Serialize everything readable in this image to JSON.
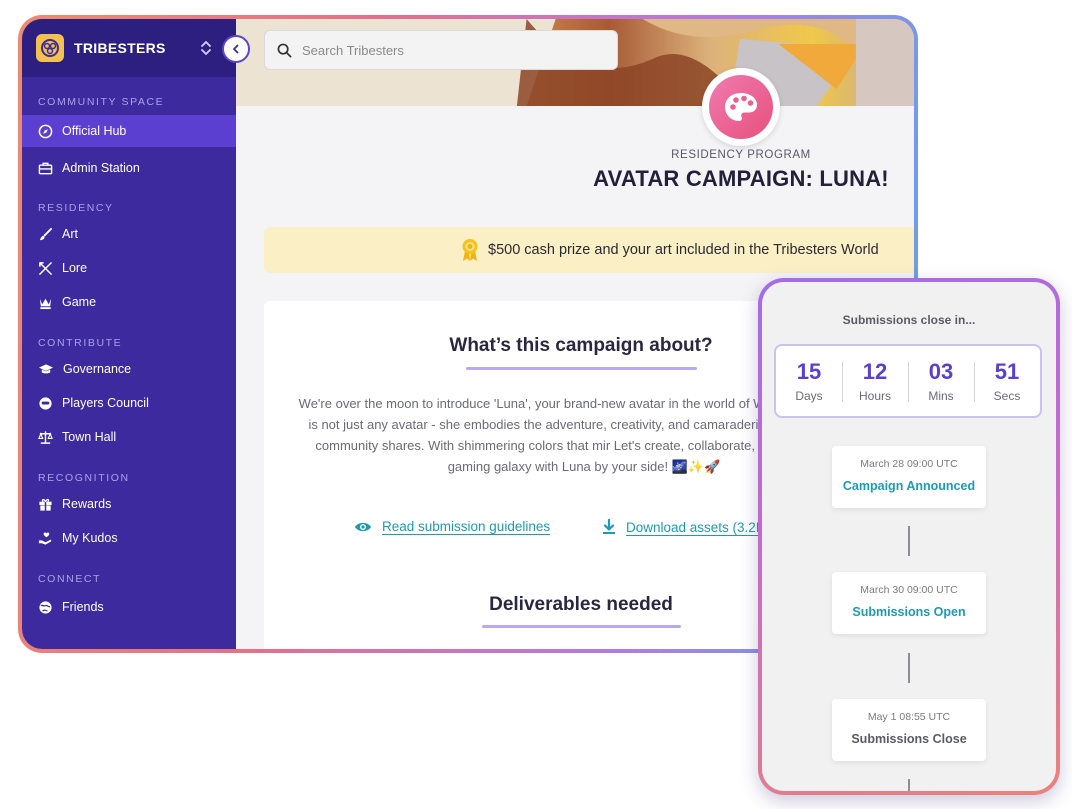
{
  "app": {
    "brand": "TRIBESTERS",
    "colors": {
      "sidebar": "#3d2a9e",
      "sidebar_active": "#5b3fd1",
      "accent": "#5a3fd0",
      "link": "#1d9bb5",
      "prize_bg": "#fbefc5"
    }
  },
  "search": {
    "placeholder": "Search Tribesters",
    "icon": "search-icon"
  },
  "sidebar": {
    "sections": [
      {
        "title": "COMMUNITY SPACE",
        "items": [
          {
            "label": "Official Hub",
            "icon": "compass-icon",
            "active": true
          },
          {
            "label": "Admin Station",
            "icon": "briefcase-icon"
          }
        ]
      },
      {
        "title": "RESIDENCY",
        "items": [
          {
            "label": "Art",
            "icon": "brush-icon"
          },
          {
            "label": "Lore",
            "icon": "crossed-tools-icon"
          },
          {
            "label": "Game",
            "icon": "chess-queen-icon"
          }
        ]
      },
      {
        "title": "CONTRIBUTE",
        "items": [
          {
            "label": "Governance",
            "icon": "graduation-cap-icon"
          },
          {
            "label": "Players Council",
            "icon": "helmet-icon"
          },
          {
            "label": "Town Hall",
            "icon": "scales-icon"
          }
        ]
      },
      {
        "title": "RECOGNITION",
        "items": [
          {
            "label": "Rewards",
            "icon": "gift-icon"
          },
          {
            "label": "My Kudos",
            "icon": "hand-heart-icon"
          }
        ]
      },
      {
        "title": "CONNECT",
        "items": [
          {
            "label": "Friends",
            "icon": "globe-icon"
          }
        ]
      }
    ]
  },
  "campaign": {
    "kicker": "RESIDENCY PROGRAM",
    "title": "AVATAR CAMPAIGN: LUNA!",
    "prize": "$500 cash prize and your art included in the Tribesters World",
    "about_heading": "What’s this campaign about?",
    "description": "We're over the moon to introduce 'Luna', your brand-new avatar in the world of Web3 gaming! Luna is not just any avatar - she embodies the adventure, creativity, and camaraderie that our gaming community shares. With shimmering colors that mir Let's create, collaborate, and conquer the gaming galaxy with Luna by your side! 🌌✨🚀",
    "guidelines_link": "Read submission guidelines",
    "assets_link": "Download assets (3.2MB)",
    "deliverables_heading": "Deliverables needed"
  },
  "countdown": {
    "title": "Submissions close in...",
    "units": [
      {
        "value": "15",
        "label": "Days"
      },
      {
        "value": "12",
        "label": "Hours"
      },
      {
        "value": "03",
        "label": "Mins"
      },
      {
        "value": "51",
        "label": "Secs"
      }
    ]
  },
  "timeline": [
    {
      "date": "March 28 09:00 UTC",
      "label": "Campaign Announced",
      "color": "#1d9bb5"
    },
    {
      "date": "March 30 09:00 UTC",
      "label": "Submissions Open",
      "color": "#1d9bb5"
    },
    {
      "date": "May 1 08:55 UTC",
      "label": "Submissions Close",
      "color": "#5b5b66"
    }
  ]
}
